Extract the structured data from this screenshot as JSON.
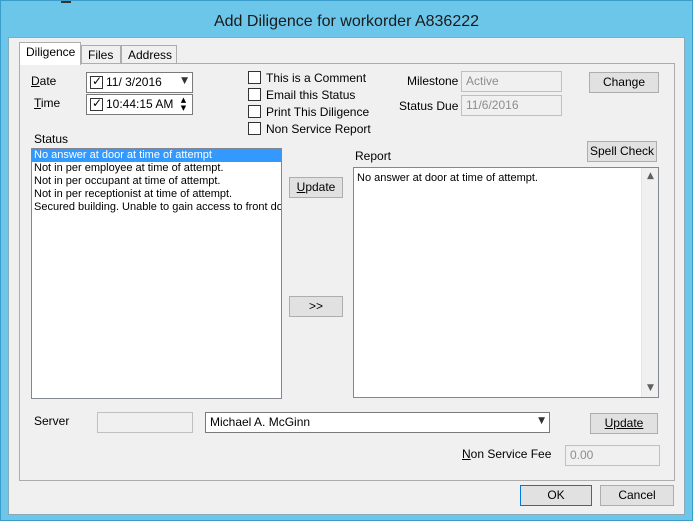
{
  "window": {
    "title": "Add Diligence for workorder A836222"
  },
  "tabs": [
    {
      "label": "Diligence"
    },
    {
      "label": "Files"
    },
    {
      "label": "Address"
    }
  ],
  "date": {
    "label": "Date",
    "value": "11/ 3/2016",
    "checked": true
  },
  "time": {
    "label": "Time",
    "value": "10:44:15 AM",
    "checked": true
  },
  "options": {
    "comment": "This is a Comment",
    "email": "Email this Status",
    "print": "Print This Diligence",
    "nonservice": "Non Service Report"
  },
  "milestone": {
    "label": "Milestone",
    "value": "Active"
  },
  "status_due": {
    "label": "Status Due",
    "value": "11/6/2016"
  },
  "change_button": "Change",
  "status": {
    "label": "Status",
    "items": [
      "No answer at door at  time of attempt",
      "Not in per employee at time of attempt.",
      "Not in per occupant at time of attempt.",
      "Not in per receptionist at time of attempt.",
      "Secured building. Unable to gain access to front door"
    ]
  },
  "update_button": "Update",
  "move_button": ">>",
  "report": {
    "label": "Report",
    "text": "No answer at door at  time of attempt."
  },
  "spell_check_button": "Spell Check",
  "server": {
    "label": "Server",
    "code": "",
    "selected": "Michael A. McGinn"
  },
  "server_update_button": "Update",
  "fee": {
    "label": "Non Service Fee",
    "value": "0.00"
  },
  "ok_button": "OK",
  "cancel_button": "Cancel"
}
